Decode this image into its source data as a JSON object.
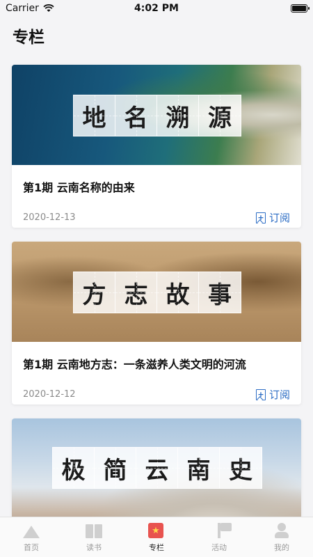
{
  "status_bar": {
    "carrier": "Carrier",
    "time": "4:02 PM"
  },
  "page": {
    "title": "专栏"
  },
  "cards": [
    {
      "banner_chars": [
        "地",
        "名",
        "溯",
        "源"
      ],
      "title": "第1期 云南名称的由来",
      "date": "2020-12-13",
      "subscribe_label": "订阅"
    },
    {
      "banner_chars": [
        "方",
        "志",
        "故",
        "事"
      ],
      "title": "第1期 云南地方志：一条滋养人类文明的河流",
      "date": "2020-12-12",
      "subscribe_label": "订阅"
    },
    {
      "banner_chars": [
        "极",
        "简",
        "云",
        "南",
        "史"
      ]
    }
  ],
  "tabbar": {
    "items": [
      {
        "label": "首页",
        "icon": "mountain-icon"
      },
      {
        "label": "读书",
        "icon": "book-icon"
      },
      {
        "label": "专栏",
        "icon": "column-icon"
      },
      {
        "label": "活动",
        "icon": "flag-icon"
      },
      {
        "label": "我的",
        "icon": "user-icon"
      }
    ],
    "active_index": 2
  },
  "colors": {
    "accent": "#2b6cc4",
    "active_tab": "#e8534f"
  }
}
